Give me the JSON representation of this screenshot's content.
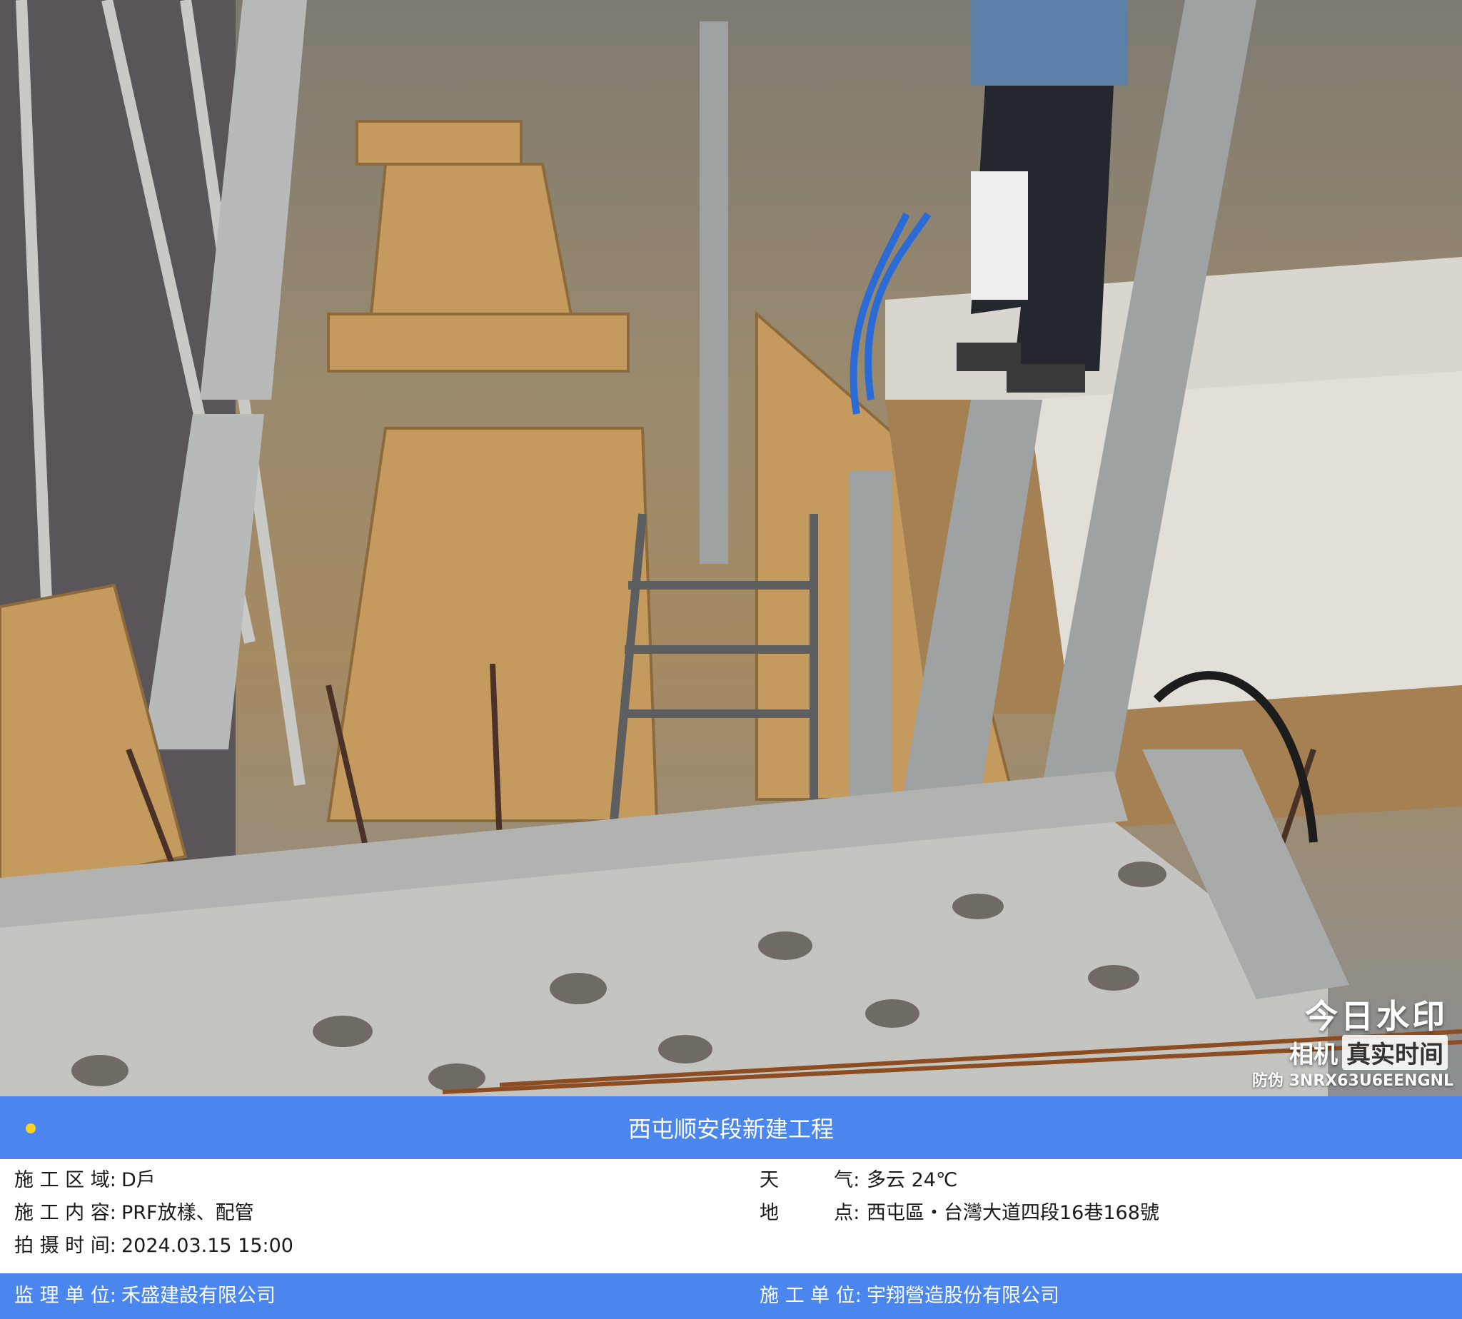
{
  "photo": {
    "description_icon": "construction-site-photo",
    "watermark": {
      "brand": "今日水印",
      "camera_label": "相机",
      "realtime_label": "真实时间",
      "anti_fake_label": "防伪",
      "anti_fake_code": "3NRX63U6EENGNL"
    }
  },
  "panel": {
    "title": "西屯顺安段新建工程",
    "area_label": "施 工 区 域:",
    "area_value": "D戶",
    "content_label": "施 工 内 容:",
    "content_value": "PRF放樣、配管",
    "time_label": "拍 摄 时 间:",
    "time_value": "2024.03.15 15:00",
    "weather_label": "天         气:",
    "weather_value": "多云 24℃",
    "location_label": "地         点:",
    "location_value": "西屯區・台灣大道四段16巷168號",
    "supervisor_label": "监 理 单 位:",
    "supervisor_value": "禾盛建設有限公司",
    "contractor_label": "施 工 单 位:",
    "contractor_value": "宇翔營造股份有限公司",
    "colors": {
      "bar": "#4b86ee",
      "dot": "#ffd21f"
    }
  }
}
